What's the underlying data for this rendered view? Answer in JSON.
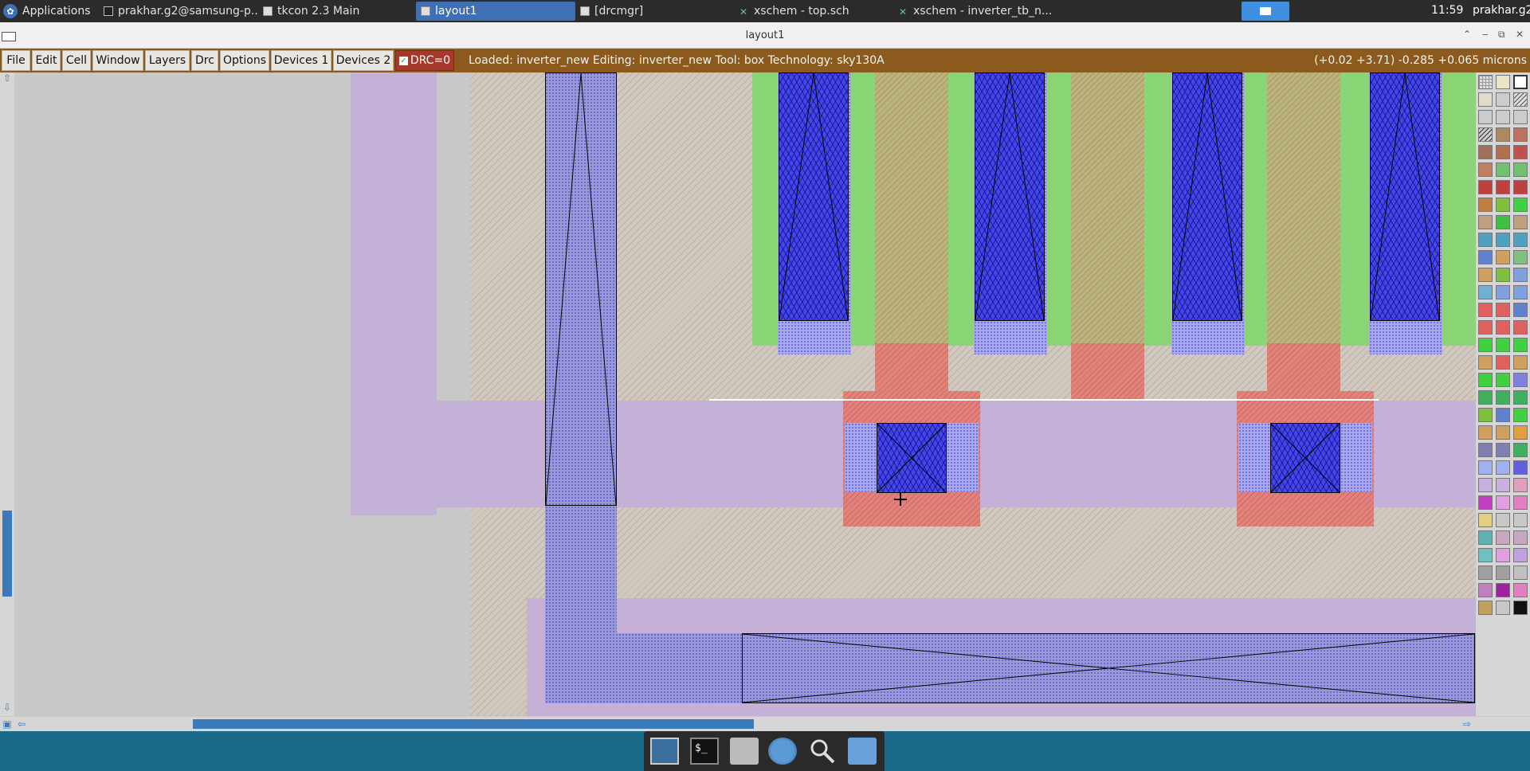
{
  "taskbar": {
    "applications_label": "Applications",
    "tasks": [
      {
        "label": "prakhar.g2@samsung-p..."
      },
      {
        "label": "tkcon 2.3 Main"
      },
      {
        "label": "layout1"
      },
      {
        "label": "[drcmgr]"
      },
      {
        "label": "xschem - top.sch"
      },
      {
        "label": "xschem - inverter_tb_n..."
      }
    ],
    "clock": "11:59",
    "user": "prakhar.g2"
  },
  "window": {
    "title": "layout1"
  },
  "menubar": {
    "items": [
      "File",
      "Edit",
      "Cell",
      "Window",
      "Layers",
      "Drc",
      "Options",
      "Devices 1",
      "Devices 2"
    ],
    "drc_label": "DRC=0",
    "status": "Loaded: inverter_new Editing: inverter_new Tool: box  Technology: sky130A",
    "coords": "(+0.02 +3.71) -0.285 +0.065 microns"
  },
  "dock": {
    "icons": [
      "monitor-icon",
      "terminal-icon",
      "home-folder-icon",
      "web-browser-icon",
      "search-icon",
      "folder-icon"
    ]
  }
}
